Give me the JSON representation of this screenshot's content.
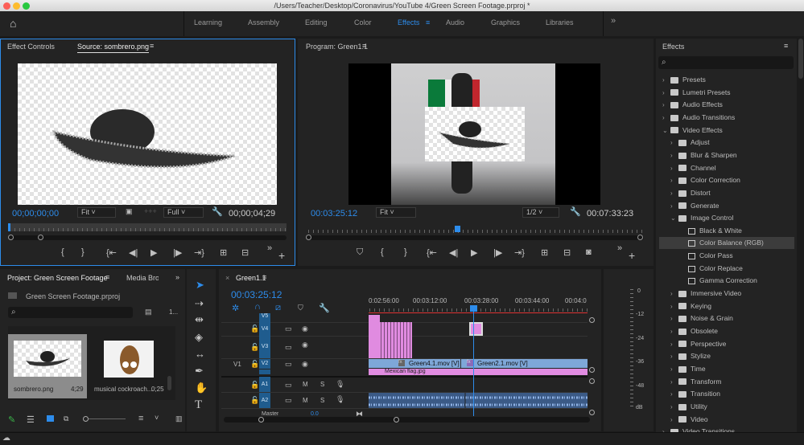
{
  "window": {
    "title": "/Users/Teacher/Desktop/Coronavirus/YouTube 4/Green Screen Footage.prproj *"
  },
  "workspaces": {
    "items": [
      "Learning",
      "Assembly",
      "Editing",
      "Color",
      "Effects",
      "Audio",
      "Graphics",
      "Libraries"
    ],
    "active": "Effects",
    "more": "»"
  },
  "source_panel": {
    "tab_effect_controls": "Effect Controls",
    "tab_source": "Source: sombrero.png",
    "timecode": "00;00;00;00",
    "zoom": "Fit",
    "resolution": "Full",
    "duration": "00;00;04;29"
  },
  "program_panel": {
    "tab": "Program: Green1.1",
    "timecode": "00:03:25:12",
    "zoom": "Fit",
    "resolution": "1/2",
    "duration": "00:07:33:23"
  },
  "effects_panel": {
    "title": "Effects",
    "search_placeholder": "",
    "tree": [
      {
        "label": "Presets",
        "level": 0,
        "type": "folder",
        "expanded": false
      },
      {
        "label": "Lumetri Presets",
        "level": 0,
        "type": "folder",
        "expanded": false
      },
      {
        "label": "Audio Effects",
        "level": 0,
        "type": "folder",
        "expanded": false
      },
      {
        "label": "Audio Transitions",
        "level": 0,
        "type": "folder",
        "expanded": false
      },
      {
        "label": "Video Effects",
        "level": 0,
        "type": "folder",
        "expanded": true
      },
      {
        "label": "Adjust",
        "level": 1,
        "type": "folder",
        "expanded": false
      },
      {
        "label": "Blur & Sharpen",
        "level": 1,
        "type": "folder",
        "expanded": false
      },
      {
        "label": "Channel",
        "level": 1,
        "type": "folder",
        "expanded": false
      },
      {
        "label": "Color Correction",
        "level": 1,
        "type": "folder",
        "expanded": false
      },
      {
        "label": "Distort",
        "level": 1,
        "type": "folder",
        "expanded": false
      },
      {
        "label": "Generate",
        "level": 1,
        "type": "folder",
        "expanded": false
      },
      {
        "label": "Image Control",
        "level": 1,
        "type": "folder",
        "expanded": true
      },
      {
        "label": "Black & White",
        "level": 2,
        "type": "effect"
      },
      {
        "label": "Color Balance (RGB)",
        "level": 2,
        "type": "effect",
        "selected": true
      },
      {
        "label": "Color Pass",
        "level": 2,
        "type": "effect"
      },
      {
        "label": "Color Replace",
        "level": 2,
        "type": "effect"
      },
      {
        "label": "Gamma Correction",
        "level": 2,
        "type": "effect"
      },
      {
        "label": "Immersive Video",
        "level": 1,
        "type": "folder",
        "expanded": false
      },
      {
        "label": "Keying",
        "level": 1,
        "type": "folder",
        "expanded": false
      },
      {
        "label": "Noise & Grain",
        "level": 1,
        "type": "folder",
        "expanded": false
      },
      {
        "label": "Obsolete",
        "level": 1,
        "type": "folder",
        "expanded": false
      },
      {
        "label": "Perspective",
        "level": 1,
        "type": "folder",
        "expanded": false
      },
      {
        "label": "Stylize",
        "level": 1,
        "type": "folder",
        "expanded": false
      },
      {
        "label": "Time",
        "level": 1,
        "type": "folder",
        "expanded": false
      },
      {
        "label": "Transform",
        "level": 1,
        "type": "folder",
        "expanded": false
      },
      {
        "label": "Transition",
        "level": 1,
        "type": "folder",
        "expanded": false
      },
      {
        "label": "Utility",
        "level": 1,
        "type": "folder",
        "expanded": false
      },
      {
        "label": "Video",
        "level": 1,
        "type": "folder",
        "expanded": false
      },
      {
        "label": "Video Transitions",
        "level": 0,
        "type": "folder",
        "expanded": false
      }
    ]
  },
  "project_panel": {
    "tab": "Project: Green Screen Footage",
    "tab2": "Media Bro",
    "file": "Green Screen Footage.prproj",
    "count": "1...",
    "items": [
      {
        "name": "sombrero.png",
        "duration": "4;29",
        "selected": true
      },
      {
        "name": "musical cockroach...",
        "duration": "0;25"
      }
    ]
  },
  "timeline": {
    "tab": "Green1.1",
    "timecode": "00:03:25:12",
    "ruler": [
      "0:02:56:00",
      "00:03:12:00",
      "00:03:28:00",
      "00:03:44:00",
      "00:04:0"
    ],
    "video_tracks": [
      "V5",
      "V4",
      "V3",
      "V2",
      "V1"
    ],
    "source_patch": "V1",
    "audio_tracks": [
      "A1",
      "A2"
    ],
    "mute": "M",
    "solo": "S",
    "master": "Master",
    "master_value": "0.0",
    "clips": [
      {
        "name": "Green4.1.mov [V]"
      },
      {
        "name": "Green2.1.mov [V]"
      },
      {
        "name": "Mexican flag.jpg"
      }
    ]
  },
  "audio_meter": {
    "labels": [
      "0",
      "-12",
      "-24",
      "-36",
      "-48",
      "dB"
    ]
  }
}
